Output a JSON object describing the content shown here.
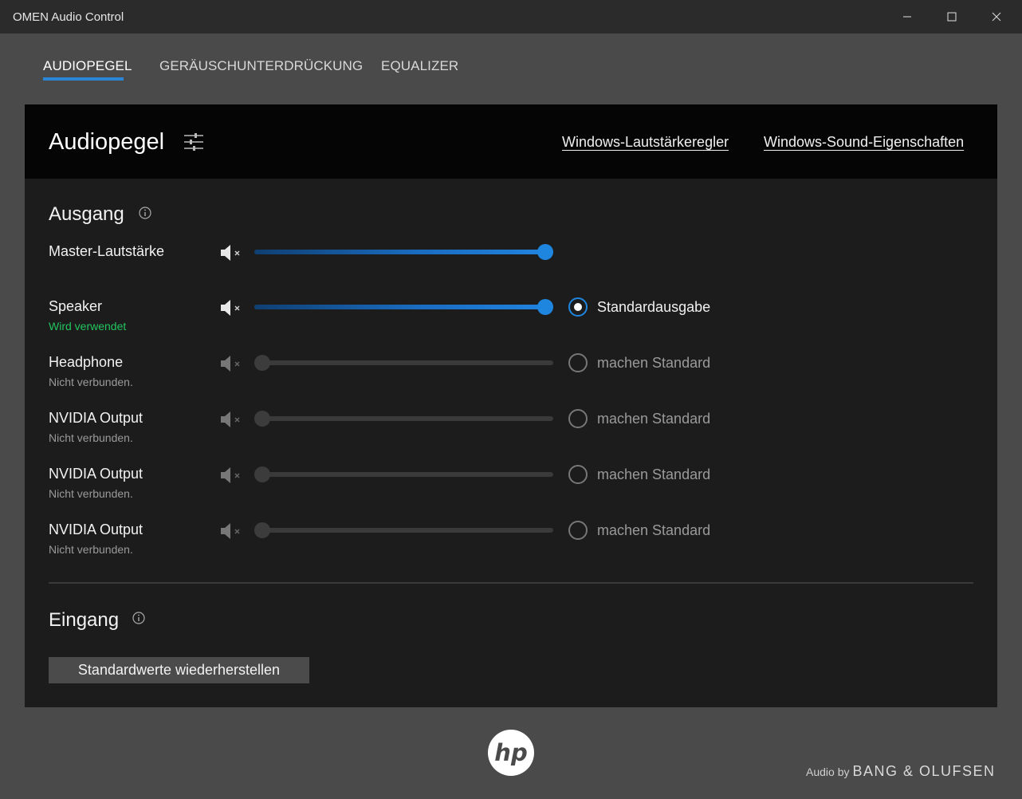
{
  "window": {
    "title": "OMEN Audio Control"
  },
  "tabs": [
    {
      "label": "AUDIOPEGEL",
      "active": true
    },
    {
      "label": "GERÄUSCHUNTERDRÜCKUNG",
      "active": false
    },
    {
      "label": "EQUALIZER",
      "active": false
    }
  ],
  "header": {
    "title": "Audiopegel",
    "link_volume_mixer": "Windows-Lautstärkeregler",
    "link_sound_properties": "Windows-Sound-Eigenschaften"
  },
  "output": {
    "title": "Ausgang",
    "master": {
      "label": "Master-Lautstärke",
      "volume": 1.0
    },
    "devices": [
      {
        "name": "Speaker",
        "status": "Wird verwendet",
        "volume": 1.0,
        "default_label": "Standardausgabe",
        "is_default": true,
        "connected": true
      },
      {
        "name": "Headphone",
        "status": "Nicht verbunden.",
        "volume": 0.0,
        "default_label": "machen Standard",
        "is_default": false,
        "connected": false
      },
      {
        "name": "NVIDIA Output",
        "status": "Nicht verbunden.",
        "volume": 0.0,
        "default_label": "machen Standard",
        "is_default": false,
        "connected": false
      },
      {
        "name": "NVIDIA Output",
        "status": "Nicht verbunden.",
        "volume": 0.0,
        "default_label": "machen Standard",
        "is_default": false,
        "connected": false
      },
      {
        "name": "NVIDIA Output",
        "status": "Nicht verbunden.",
        "volume": 0.0,
        "default_label": "machen Standard",
        "is_default": false,
        "connected": false
      }
    ]
  },
  "input": {
    "title": "Eingang"
  },
  "reset_button": "Standardwerte wiederherstellen",
  "footer": {
    "hp_logo_text": "hp",
    "audio_by": "Audio by",
    "brand": "BANG & OLUFSEN"
  },
  "colors": {
    "accent": "#1f86e0",
    "active_status": "#22c55e",
    "panel": "#1c1c1c",
    "header": "#050505",
    "background": "#4a4a4a"
  }
}
